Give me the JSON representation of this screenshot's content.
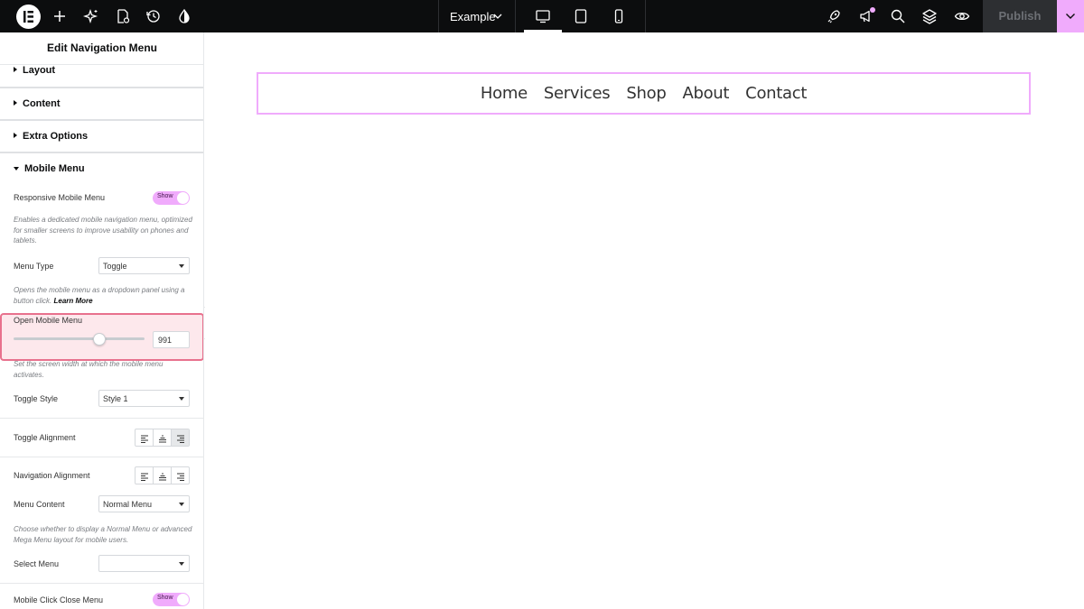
{
  "topbar": {
    "document_name": "Example",
    "publish_label": "Publish",
    "icons": [
      "elementor-logo",
      "add-icon",
      "ai-sparkle-icon",
      "page-settings-icon",
      "history-icon",
      "site-settings-icon",
      "desktop-icon",
      "tablet-icon",
      "mobile-icon",
      "rocket-icon",
      "megaphone-icon",
      "search-icon",
      "layers-icon",
      "preview-eye-icon",
      "chevron-down-icon"
    ],
    "accent_color": "#f0abfc"
  },
  "panel": {
    "title": "Edit Navigation Menu",
    "sections": {
      "layout": "Layout",
      "content": "Content",
      "extra_options": "Extra Options",
      "mobile_menu": "Mobile Menu"
    },
    "controls": {
      "responsive_mobile_menu": {
        "label": "Responsive Mobile Menu",
        "value": "Show",
        "description": "Enables a dedicated mobile navigation menu, optimized for smaller screens to improve usability on phones and tablets."
      },
      "menu_type": {
        "label": "Menu Type",
        "value": "Toggle",
        "description": "Opens the mobile menu as a dropdown panel using a button click.",
        "link": "Learn More"
      },
      "open_mobile_menu": {
        "label": "Open Mobile Menu",
        "value": "991",
        "slider_fraction": 0.65,
        "description": "Set the screen width at which the mobile menu activates."
      },
      "toggle_style": {
        "label": "Toggle Style",
        "value": "Style 1"
      },
      "toggle_alignment": {
        "label": "Toggle Alignment",
        "active": "right"
      },
      "navigation_alignment": {
        "label": "Navigation Alignment"
      },
      "menu_content": {
        "label": "Menu Content",
        "value": "Normal Menu",
        "description": "Choose whether to display a Normal Menu or advanced Mega Menu layout for mobile users."
      },
      "select_menu": {
        "label": "Select Menu",
        "value": ""
      },
      "mobile_click_close_menu": {
        "label": "Mobile Click Close Menu",
        "value": "Show"
      }
    }
  },
  "canvas": {
    "nav_items": [
      "Home",
      "Services",
      "Shop",
      "About",
      "Contact"
    ]
  }
}
